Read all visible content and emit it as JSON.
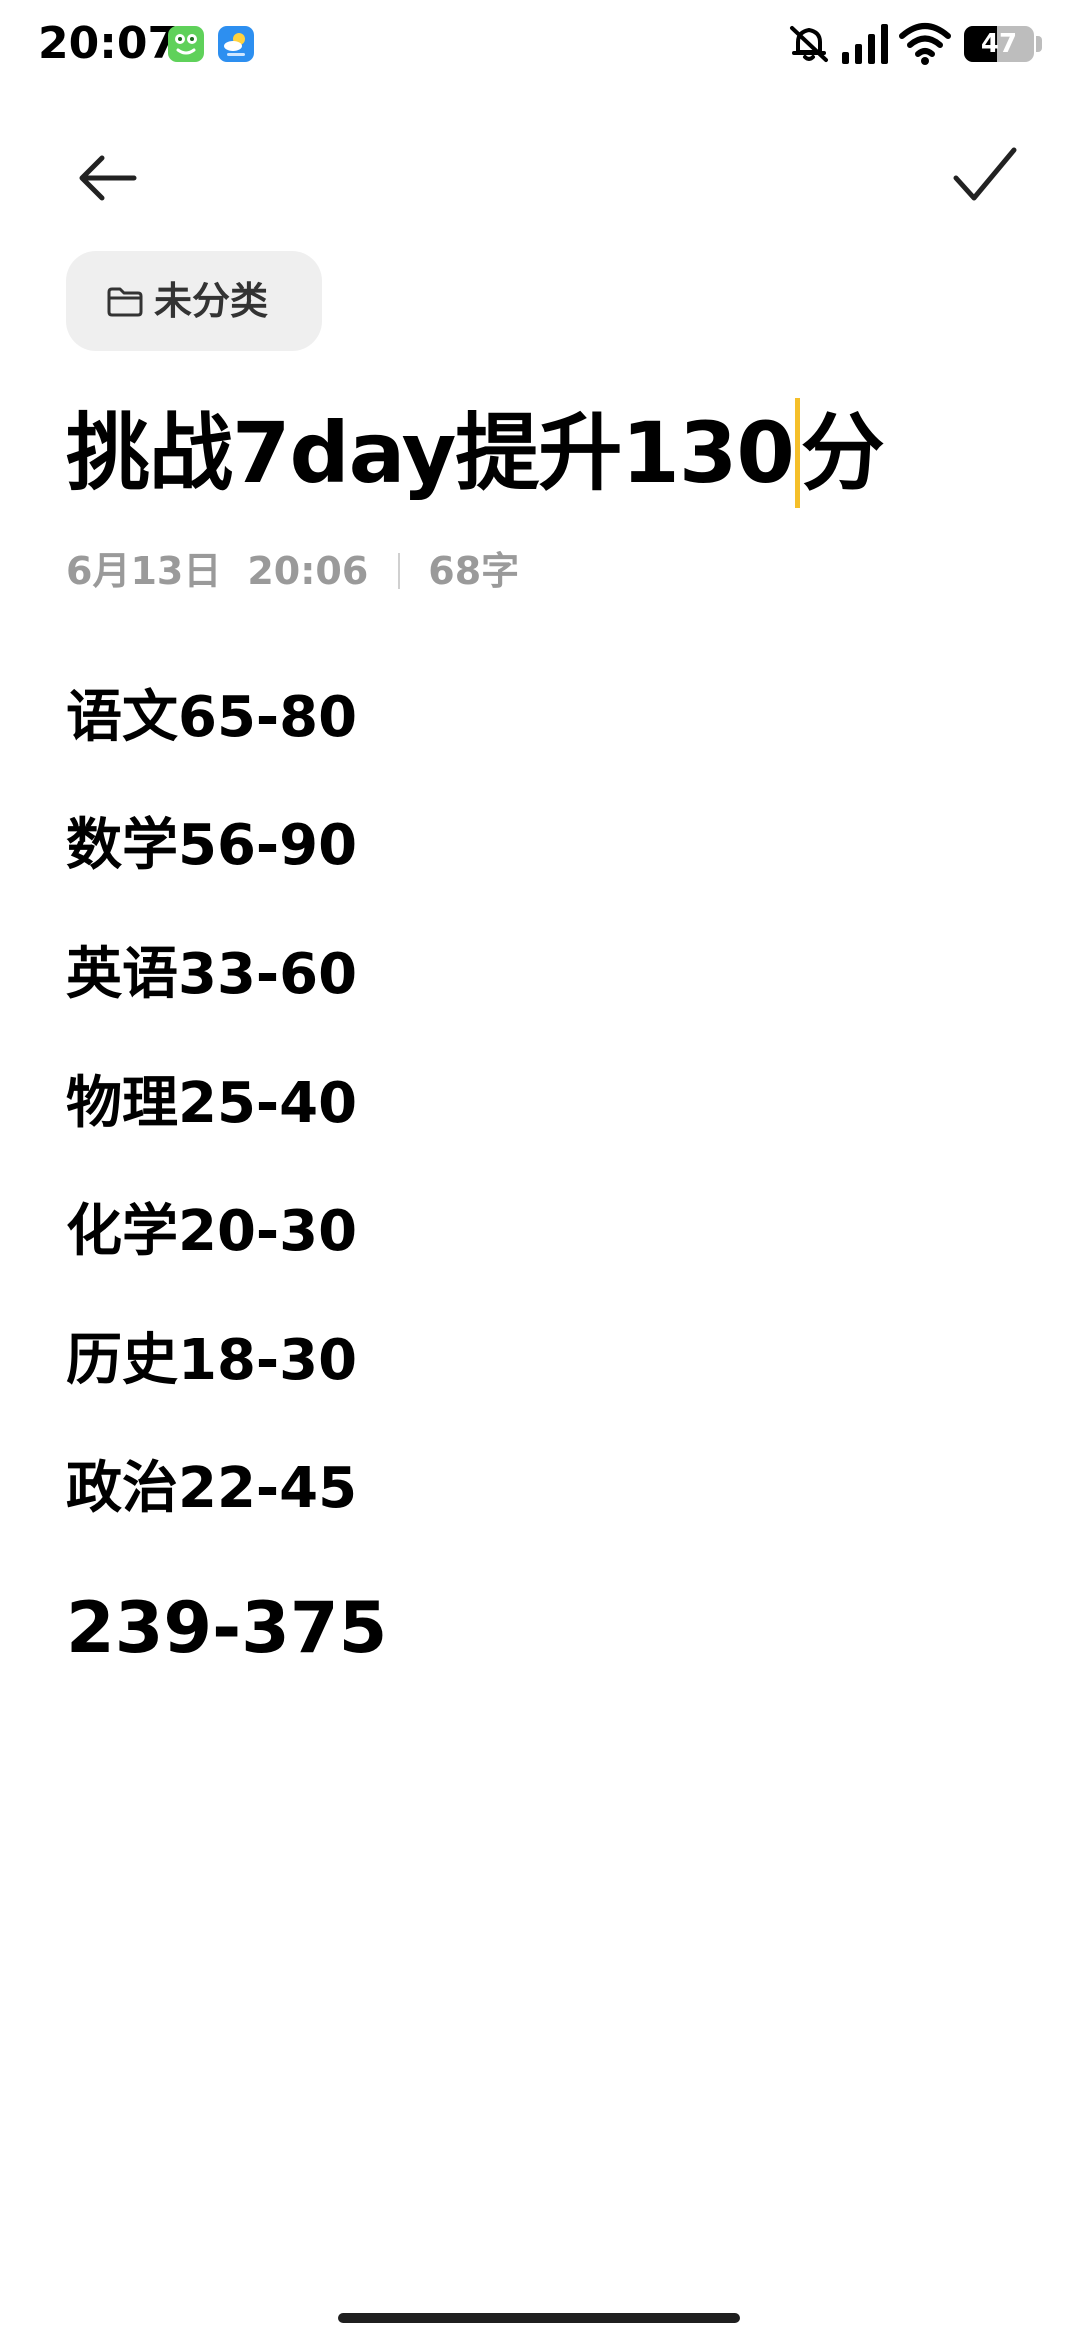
{
  "status_bar": {
    "time": "20:07",
    "battery_level": "47",
    "notifications": [
      "frog-app-icon",
      "weather-app-icon"
    ],
    "system_icons": [
      "mute-icon",
      "signal-icon",
      "wifi-icon",
      "battery-icon"
    ]
  },
  "toolbar": {
    "back_icon": "arrow-left-icon",
    "confirm_icon": "checkmark-icon"
  },
  "category": {
    "label": "未分类",
    "icon": "folder-icon"
  },
  "note": {
    "title_before_cursor": "挑战7day提升130",
    "title_after_cursor": "分",
    "date": "6月13日",
    "time": "20:06",
    "char_count": "68字",
    "lines": [
      "语文65-80",
      "数学56-90",
      "英语33-60",
      "物理25-40",
      "化学20-30",
      "历史18-30",
      "政治22-45"
    ],
    "total": "239-375"
  },
  "colors": {
    "cursor": "#f5bf2a",
    "chip_background": "#efefef",
    "meta_text": "#9a9a9a"
  }
}
